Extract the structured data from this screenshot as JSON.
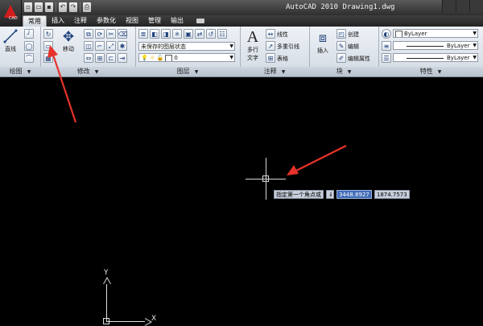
{
  "window": {
    "title": "AutoCAD 2010  Drawing1.dwg",
    "app_logo_letter": "A",
    "app_logo_caption": "CAD"
  },
  "quick_access": {
    "icons": [
      "new-icon",
      "open-icon",
      "save-icon",
      "undo-icon",
      "redo-icon",
      "plot-icon"
    ]
  },
  "tabs": [
    {
      "label": "常用",
      "active": true
    },
    {
      "label": "插入",
      "active": false
    },
    {
      "label": "注释",
      "active": false
    },
    {
      "label": "参数化",
      "active": false
    },
    {
      "label": "视图",
      "active": false
    },
    {
      "label": "管理",
      "active": false
    },
    {
      "label": "输出",
      "active": false
    }
  ],
  "ribbon": {
    "draw": {
      "title": "绘图",
      "line_label": "直线"
    },
    "modify": {
      "title": "修改",
      "move_label": "移动"
    },
    "layers": {
      "title": "图层",
      "layer_state": "未保存的图层状态",
      "current_layer": "0"
    },
    "annotation": {
      "title": "注释",
      "mtext_label_1": "多行",
      "mtext_label_2": "文字",
      "linear_label": "线性",
      "mleader_label": "多重引线",
      "table_label": "表格"
    },
    "block": {
      "title": "块",
      "insert_label": "插入",
      "create_label": "创建",
      "edit_label": "编辑",
      "edit_attr_label": "编辑属性"
    },
    "properties": {
      "title": "特性",
      "color": "ByLayer",
      "linetype": "ByLayer",
      "lineweight": "ByLayer"
    }
  },
  "canvas": {
    "prompt": "指定第一个角点或",
    "coord_x": "3448.8927",
    "coord_y": "1874.7573",
    "ucs_y": "Y",
    "ucs_x": "X"
  },
  "colors": {
    "annotation_arrow": "#e8322a",
    "logo_red": "#d21d1d",
    "canvas_bg": "#000000",
    "coord_highlight": "#3f6bb8"
  }
}
